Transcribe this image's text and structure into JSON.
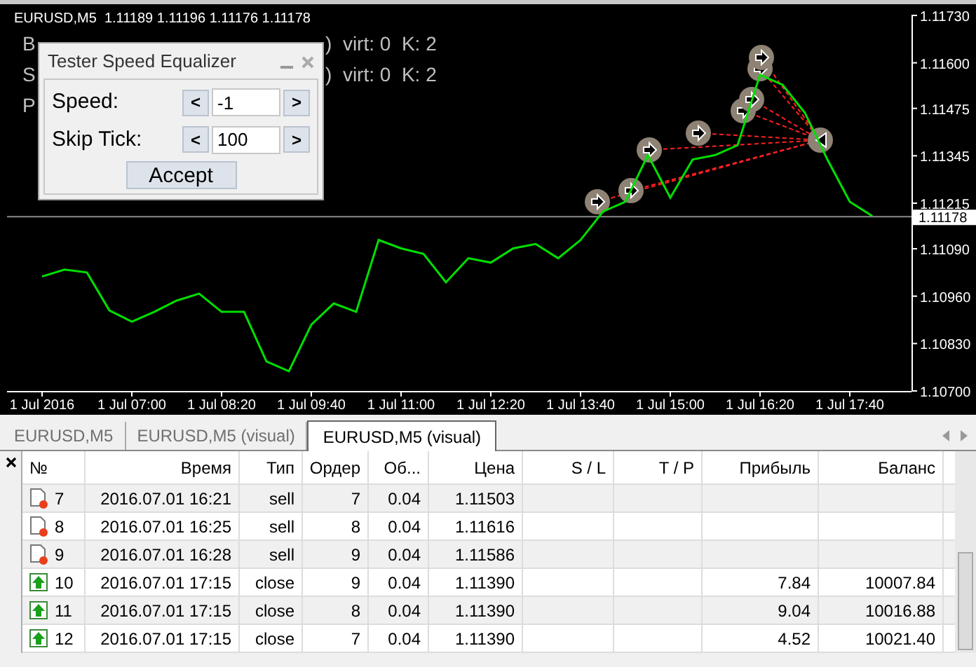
{
  "chart": {
    "header": "EURUSD,M5  1.11189 1.11196 1.11176 1.11178",
    "chart_data": {
      "type": "line",
      "categories": [
        "1 Jul 2016",
        null,
        null,
        null,
        "1 Jul 07:00",
        null,
        null,
        null,
        "1 Jul 08:20",
        null,
        null,
        null,
        "1 Jul 09:40",
        null,
        null,
        null,
        "1 Jul 11:00",
        null,
        null,
        null,
        "1 Jul 12:20",
        null,
        null,
        null,
        "1 Jul 13:40",
        null,
        null,
        null,
        "1 Jul 15:00",
        null,
        null,
        null,
        "1 Jul 16:20",
        null,
        null,
        null,
        "1 Jul 17:40",
        null
      ],
      "series": [
        {
          "color": "#00e000",
          "values": [
            1.11014,
            1.11033,
            1.11025,
            1.10921,
            1.1089,
            1.10917,
            1.10948,
            1.10967,
            1.10917,
            1.10917,
            1.10781,
            1.10754,
            1.10882,
            1.1094,
            1.10917,
            1.11114,
            1.11091,
            1.11076,
            1.10998,
            1.11064,
            1.11052,
            1.11091,
            1.11103,
            1.11064,
            1.11114,
            1.11192,
            1.11219,
            1.11347,
            1.1123,
            1.11335,
            1.11347,
            1.11374,
            1.11567,
            1.1154,
            1.11463,
            1.11335,
            1.11219,
            1.1118
          ]
        }
      ],
      "yticks": [
        {
          "value": 1.1173,
          "label": "1.11730"
        },
        {
          "value": 1.116,
          "label": "1.11600"
        },
        {
          "value": 1.11475,
          "label": "1.11475"
        },
        {
          "value": 1.11345,
          "label": "1.11345"
        },
        {
          "value": 1.11215,
          "label": "1.11215"
        },
        {
          "value": 1.1109,
          "label": "1.11090"
        },
        {
          "value": 1.1096,
          "label": "1.10960"
        },
        {
          "value": 1.1083,
          "label": "1.10830"
        },
        {
          "value": 1.107,
          "label": "1.10700"
        }
      ],
      "ylim": [
        1.107,
        1.1173
      ],
      "ref_lines": [
        {
          "axis": "y",
          "value": 1.11178,
          "label": "1.11178",
          "color": "#8a8a8a"
        }
      ]
    }
  },
  "chart_text": [
    {
      "left": "B",
      "right": ")  virt: 0  K: 2"
    },
    {
      "left": "S",
      "right": ")  virt: 0  K: 2"
    },
    {
      "left": "P"
    }
  ],
  "panel": {
    "title": "Tester Speed Equalizer",
    "fields": [
      {
        "label": "Speed:",
        "decrease": "<",
        "value": "-1",
        "increase": ">"
      },
      {
        "label": "Skip Tick:",
        "decrease": "<",
        "value": "100",
        "increase": ">"
      }
    ],
    "accept": "Accept"
  },
  "tabs": [
    {
      "label": "EURUSD,M5",
      "selected": false
    },
    {
      "label": "EURUSD,M5 (visual)",
      "selected": false
    },
    {
      "label": "EURUSD,M5 (visual)",
      "selected": true
    }
  ],
  "table": {
    "columns": [
      "№",
      "Время",
      "Тип",
      "Ордер",
      "Об...",
      "Цена",
      "S / L",
      "T / P",
      "Прибыль",
      "Баланс"
    ],
    "rows": [
      {
        "kind": "sell",
        "cells": [
          "7",
          "2016.07.01 16:21",
          "sell",
          "7",
          "0.04",
          "1.11503",
          "",
          "",
          "",
          ""
        ]
      },
      {
        "kind": "sell",
        "cells": [
          "8",
          "2016.07.01 16:25",
          "sell",
          "8",
          "0.04",
          "1.11616",
          "",
          "",
          "",
          ""
        ]
      },
      {
        "kind": "sell",
        "cells": [
          "9",
          "2016.07.01 16:28",
          "sell",
          "9",
          "0.04",
          "1.11586",
          "",
          "",
          "",
          ""
        ]
      },
      {
        "kind": "close",
        "cells": [
          "10",
          "2016.07.01 17:15",
          "close",
          "9",
          "0.04",
          "1.11390",
          "",
          "",
          "7.84",
          "10007.84"
        ]
      },
      {
        "kind": "close",
        "cells": [
          "11",
          "2016.07.01 17:15",
          "close",
          "8",
          "0.04",
          "1.11390",
          "",
          "",
          "9.04",
          "10016.88"
        ]
      },
      {
        "kind": "close",
        "cells": [
          "12",
          "2016.07.01 17:15",
          "close",
          "7",
          "0.04",
          "1.11390",
          "",
          "",
          "4.52",
          "10021.40"
        ]
      }
    ]
  }
}
